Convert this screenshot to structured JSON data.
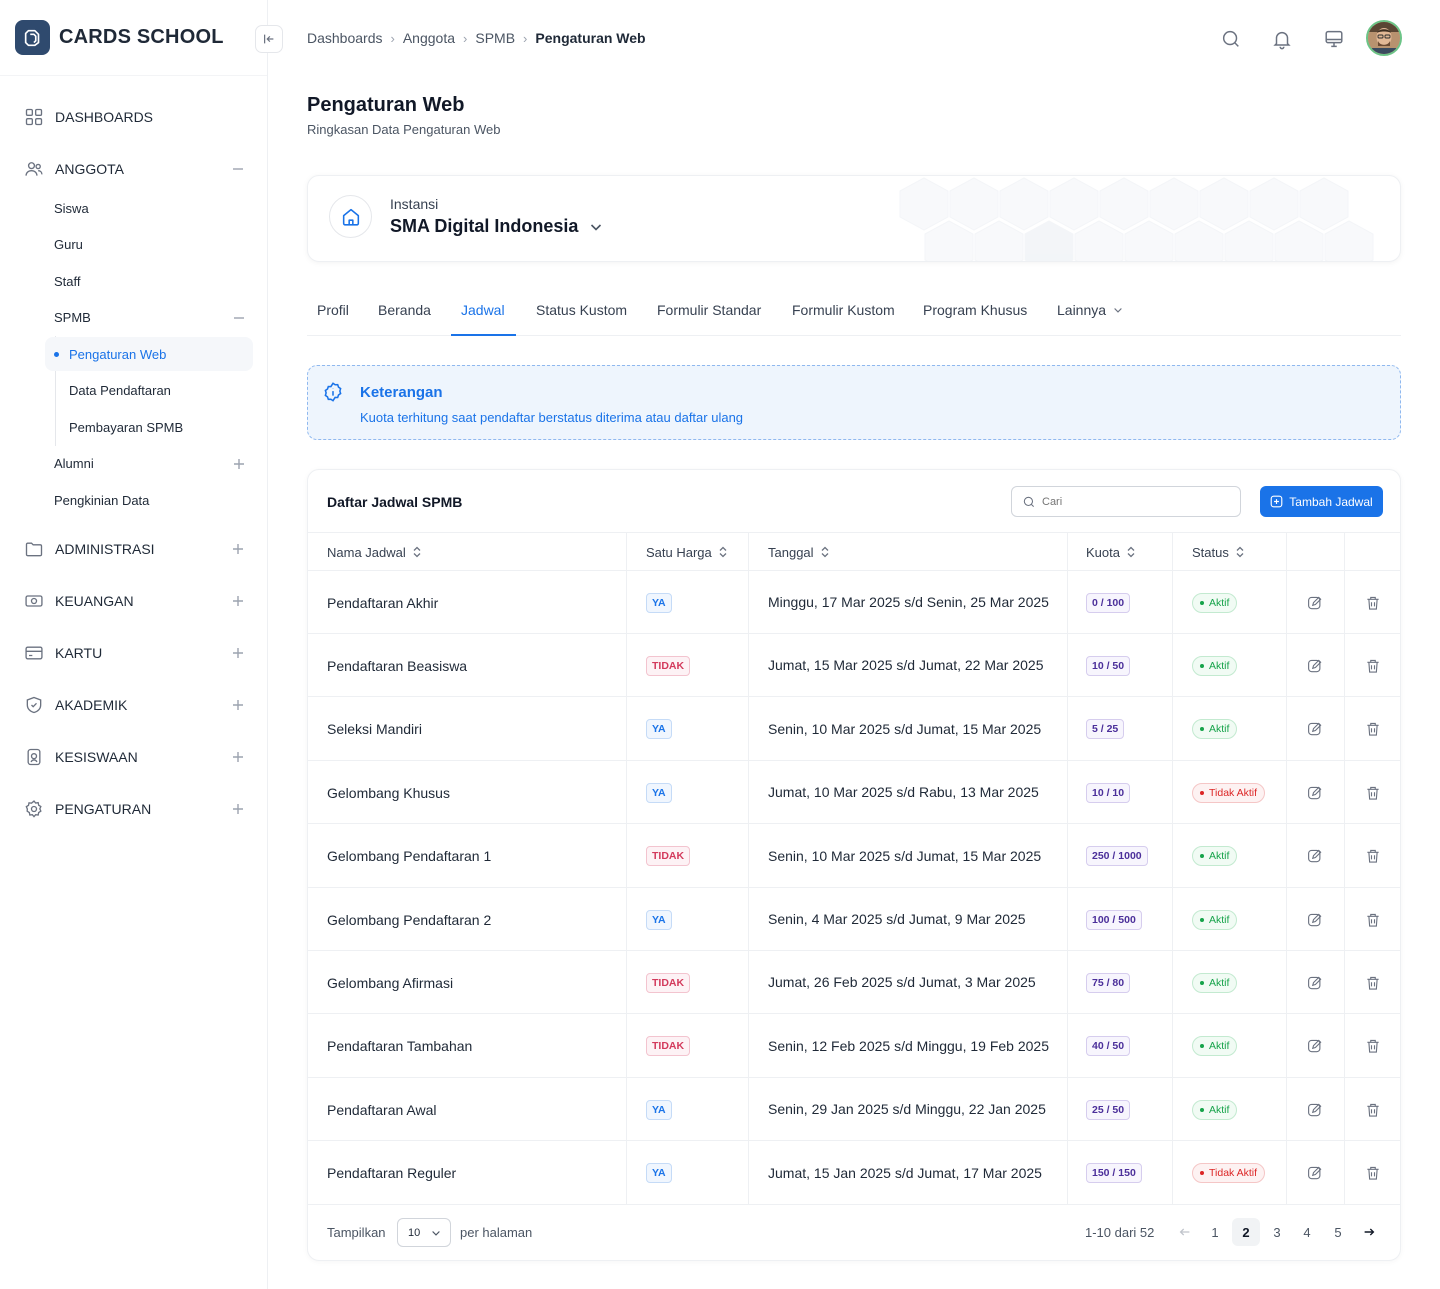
{
  "brand": {
    "name": "CARDS SCHOOL"
  },
  "sidebar": {
    "dashboards": "DASHBOARDS",
    "anggota": "ANGGOTA",
    "siswa": "Siswa",
    "guru": "Guru",
    "staff": "Staff",
    "spmb": "SPMB",
    "pengaturan_web": "Pengaturan Web",
    "data_pendaftaran": "Data Pendaftaran",
    "pembayaran_spmb": "Pembayaran SPMB",
    "alumni": "Alumni",
    "pengkinian_data": "Pengkinian Data",
    "administrasi": "ADMINISTRASI",
    "keuangan": "KEUANGAN",
    "kartu": "KARTU",
    "akademik": "AKADEMIK",
    "kesiswaan": "KESISWAAN",
    "pengaturan": "PENGATURAN"
  },
  "breadcrumb": [
    "Dashboards",
    "Anggota",
    "SPMB",
    "Pengaturan Web"
  ],
  "page": {
    "title": "Pengaturan Web",
    "subtitle": "Ringkasan Data Pengaturan Web"
  },
  "instansi": {
    "label": "Instansi",
    "name": "SMA Digital Indonesia"
  },
  "tabs": [
    "Profil",
    "Beranda",
    "Jadwal",
    "Status Kustom",
    "Formulir Standar",
    "Formulir Kustom",
    "Program Khusus",
    "Lainnya"
  ],
  "alert": {
    "title": "Keterangan",
    "text": "Kuota terhitung saat pendaftar berstatus diterima atau daftar ulang"
  },
  "table": {
    "title": "Daftar Jadwal SPMB",
    "search_placeholder": "Cari",
    "add_label": "Tambah Jadwal",
    "headers": {
      "name": "Nama Jadwal",
      "satu_harga": "Satu Harga",
      "tanggal": "Tanggal",
      "kuota": "Kuota",
      "status": "Status"
    },
    "rows": [
      {
        "name": "Pendaftaran Akhir",
        "satu_harga": "YA",
        "tanggal": "Minggu, 17 Mar 2025 s/d Senin, 25 Mar 2025",
        "kuota": "0 / 100",
        "status": "Aktif"
      },
      {
        "name": "Pendaftaran Beasiswa",
        "satu_harga": "TIDAK",
        "tanggal": "Jumat, 15 Mar 2025 s/d Jumat, 22 Mar 2025",
        "kuota": "10 / 50",
        "status": "Aktif"
      },
      {
        "name": "Seleksi Mandiri",
        "satu_harga": "YA",
        "tanggal": "Senin, 10 Mar 2025 s/d Jumat, 15 Mar 2025",
        "kuota": "5 / 25",
        "status": "Aktif"
      },
      {
        "name": "Gelombang Khusus",
        "satu_harga": "YA",
        "tanggal": "Jumat, 10 Mar 2025 s/d Rabu, 13 Mar 2025",
        "kuota": "10 / 10",
        "status": "Tidak Aktif"
      },
      {
        "name": "Gelombang Pendaftaran 1",
        "satu_harga": "TIDAK",
        "tanggal": "Senin, 10 Mar 2025 s/d Jumat, 15 Mar 2025",
        "kuota": "250 / 1000",
        "status": "Aktif"
      },
      {
        "name": "Gelombang Pendaftaran 2",
        "satu_harga": "YA",
        "tanggal": "Senin, 4 Mar 2025 s/d Jumat, 9 Mar 2025",
        "kuota": "100 / 500",
        "status": "Aktif"
      },
      {
        "name": "Gelombang Afirmasi",
        "satu_harga": "TIDAK",
        "tanggal": "Jumat, 26 Feb 2025 s/d Jumat, 3 Mar 2025",
        "kuota": "75 / 80",
        "status": "Aktif"
      },
      {
        "name": "Pendaftaran Tambahan",
        "satu_harga": "TIDAK",
        "tanggal": "Senin, 12 Feb 2025 s/d Minggu, 19 Feb 2025",
        "kuota": "40 / 50",
        "status": "Aktif"
      },
      {
        "name": "Pendaftaran Awal",
        "satu_harga": "YA",
        "tanggal": "Senin, 29 Jan 2025 s/d Minggu, 22 Jan 2025",
        "kuota": "25 / 50",
        "status": "Aktif"
      },
      {
        "name": "Pendaftaran Reguler",
        "satu_harga": "YA",
        "tanggal": "Jumat, 15 Jan 2025 s/d Jumat, 17 Mar 2025",
        "kuota": "150 / 150",
        "status": "Tidak Aktif"
      }
    ]
  },
  "pagination": {
    "show_label": "Tampilkan",
    "per_page": "10",
    "per_page_label": "per halaman",
    "info": "1-10 dari 52",
    "pages": [
      "1",
      "2",
      "3",
      "4",
      "5"
    ],
    "current": "2"
  },
  "colors": {
    "accent": "#1a73e8",
    "brand": "#2f4a6e",
    "success": "#16a34a",
    "danger": "#dc2626"
  }
}
